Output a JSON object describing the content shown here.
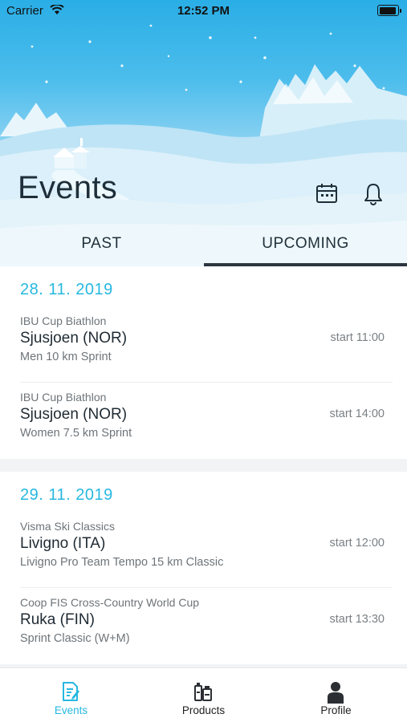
{
  "status_bar": {
    "carrier": "Carrier",
    "time": "12:52 PM"
  },
  "header": {
    "title": "Events"
  },
  "tabs": [
    {
      "label": "PAST"
    },
    {
      "label": "UPCOMING",
      "selected": true
    }
  ],
  "days": [
    {
      "date": "28. 11. 2019",
      "events": [
        {
          "series": "IBU Cup Biathlon",
          "place": "Sjusjoen (NOR)",
          "desc": "Men 10 km Sprint",
          "start": "start 11:00"
        },
        {
          "series": "IBU Cup Biathlon",
          "place": "Sjusjoen (NOR)",
          "desc": "Women 7.5 km Sprint",
          "start": "start 14:00"
        }
      ]
    },
    {
      "date": "29. 11. 2019",
      "events": [
        {
          "series": "Visma Ski Classics",
          "place": "Livigno (ITA)",
          "desc": "Livigno Pro Team Tempo 15 km Classic",
          "start": "start 12:00"
        },
        {
          "series": "Coop FIS Cross-Country World Cup",
          "place": "Ruka (FIN)",
          "desc": "Sprint Classic (W+M)",
          "start": "start 13:30"
        }
      ]
    }
  ],
  "tabbar": [
    {
      "label": "Events",
      "icon": "events-icon",
      "active": true
    },
    {
      "label": "Products",
      "icon": "products-icon"
    },
    {
      "label": "Profile",
      "icon": "profile-icon"
    }
  ],
  "colors": {
    "accent": "#27b8e0",
    "sky": "#2aaee6",
    "text": "#1f2f3a",
    "indicator": "#2c3640"
  }
}
